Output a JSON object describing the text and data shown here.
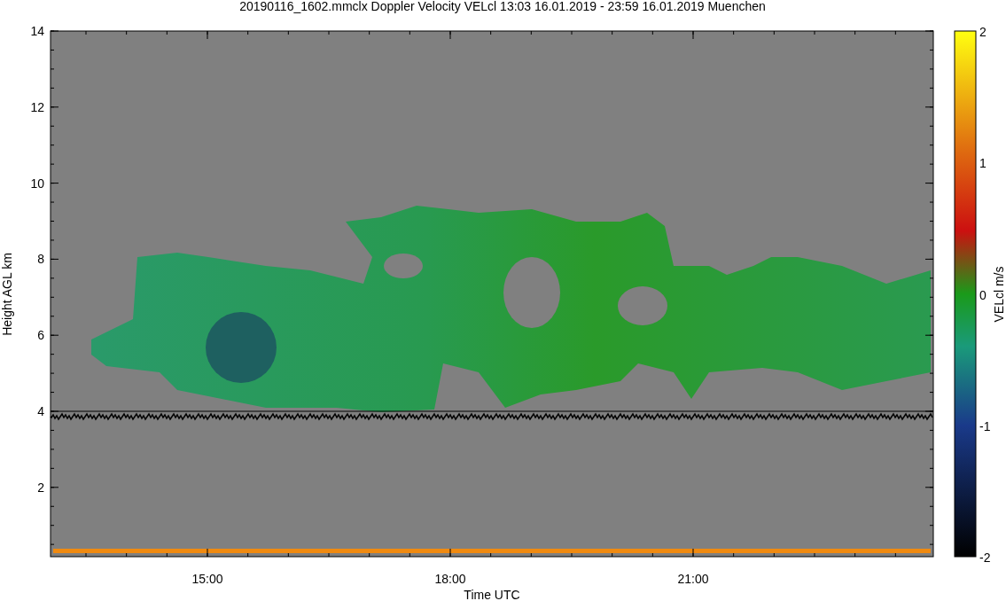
{
  "title": "20190116_1602.mmclx Doppler Velocity VELcl   13:03 16.01.2019 - 23:59 16.01.2019 Muenchen",
  "plot": {
    "ylabel": "Height AGL km",
    "xlabel": "Time UTC",
    "yticks": [
      "14",
      "12",
      "10",
      "8",
      "6",
      "4",
      "2"
    ],
    "xticks": [
      "15:00",
      "18:00",
      "21:00"
    ]
  },
  "colorbar": {
    "label": "VELcl m/s",
    "ticks": [
      "2",
      "1",
      "0",
      "-1",
      "-2"
    ]
  }
}
